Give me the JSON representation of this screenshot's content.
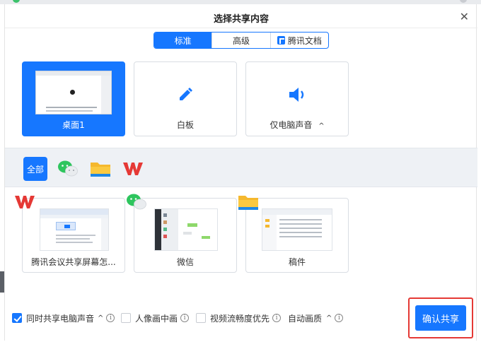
{
  "dialog": {
    "title": "选择共享内容"
  },
  "tabs": [
    {
      "label": "标准",
      "active": true
    },
    {
      "label": "高级",
      "active": false
    },
    {
      "label": "腾讯文档",
      "active": false
    }
  ],
  "top_cards": [
    {
      "label": "桌面1",
      "selected": true
    },
    {
      "label": "白板",
      "selected": false
    },
    {
      "label": "仅电脑声音",
      "selected": false,
      "caret": "^"
    }
  ],
  "filters": [
    {
      "label": "全部",
      "icon": "all",
      "active": true
    },
    {
      "icon": "wechat-icon"
    },
    {
      "icon": "folder-icon"
    },
    {
      "icon": "wps-icon"
    }
  ],
  "windows": [
    {
      "label": "腾讯会议共享屏幕怎...",
      "app_icon": "wps-icon"
    },
    {
      "label": "微信",
      "app_icon": "wechat-icon"
    },
    {
      "label": "稿件",
      "app_icon": "folder-icon"
    }
  ],
  "options": [
    {
      "label": "同时共享电脑声音",
      "checked": true,
      "caret": "^",
      "info": "i"
    },
    {
      "label": "人像画中画",
      "checked": false,
      "info": "i"
    },
    {
      "label": "视频流畅度优先",
      "checked": false,
      "info": "i"
    },
    {
      "label": "自动画质",
      "caret": "^",
      "info": "i"
    }
  ],
  "confirm_label": "确认共享",
  "colors": {
    "accent": "#1677ff",
    "highlight": "#e53935"
  }
}
